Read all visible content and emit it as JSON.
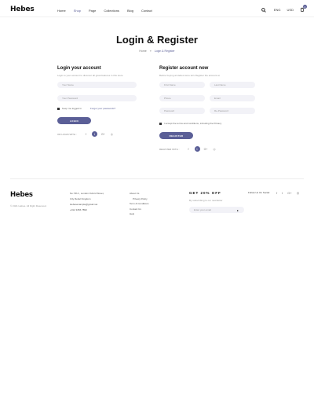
{
  "header": {
    "logo": "Hebes",
    "nav": [
      "Home",
      "Shop",
      "Page",
      "Collections",
      "Blog",
      "Contact"
    ],
    "active_nav": 1,
    "currency": "ENG",
    "language": "USD",
    "cart_count": "0"
  },
  "page": {
    "title": "Login & Register",
    "breadcrumb": [
      "Home",
      "Login & Register"
    ]
  },
  "login": {
    "title": "Login your account",
    "subtitle": "Login to your account to discover all great features in this store.",
    "email_placeholder": "Your Name",
    "password_placeholder": "Your Password",
    "remember": "Keep me logged in",
    "forgot": "Forgot your passwords?",
    "button": "LOGIN",
    "social_label": "OR LOGIN WITH :"
  },
  "register": {
    "title": "Register account now",
    "subtitle": "Before buying at Hebes store let's Register the account at.",
    "first_name": "First Name",
    "last_name": "Last Name",
    "phone": "Phone",
    "email": "Email",
    "password": "Password",
    "confirm": "Re-Password",
    "terms": "I accept the terms and conditions, including the Privacy",
    "button": "REGISTER",
    "social_label": "REGISTER WITH :"
  },
  "social_icons": [
    "facebook-icon",
    "twitter-icon",
    "google-plus-icon",
    "instagram-icon"
  ],
  "footer": {
    "logo": "Hebes",
    "copyright": "© 2021 Hebes. All Right Reserved.",
    "address": [
      "No: 58 A , London Oxford Street,",
      "City Rebel Kingdom",
      "Hebesexample@gmail.net",
      "+012 3456 7890"
    ],
    "links": [
      "About Us",
      "Privacy Policy",
      "Term & Conditions",
      "Contact Us",
      "Help"
    ],
    "newsletter_title": "GET 20% OFF",
    "newsletter_sub": "By subscribing to our newsletter",
    "newsletter_placeholder": "Enter your email",
    "follow": "Follow Us On Social:"
  },
  "colors": {
    "accent": "#5b5f97",
    "field_bg": "#f2f2f7"
  }
}
